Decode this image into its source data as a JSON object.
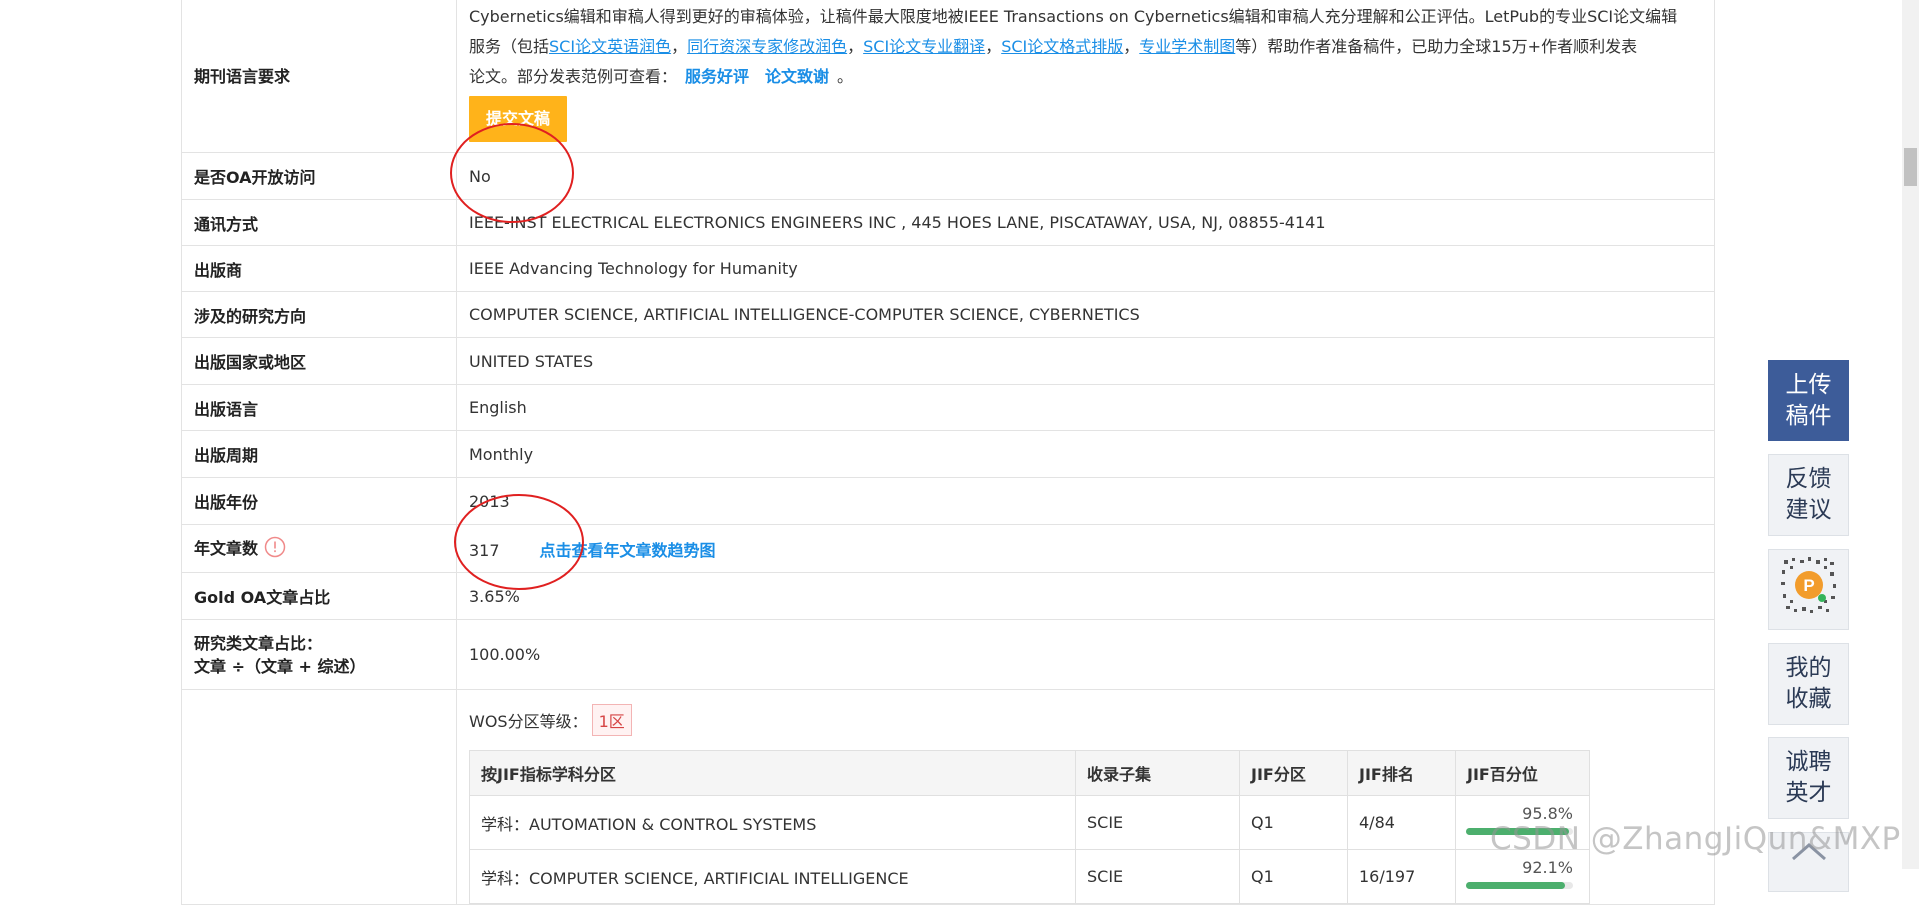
{
  "rows": {
    "lang_req": {
      "label": "期刊语言要求",
      "line1": "Cybernetics编辑和审稿人得到更好的审稿体验，让稿件最大限度地被IEEE Transactions on Cybernetics编辑和审稿人充分理解和公正评估。LetPub的专业SCI论文编辑",
      "line2_prefix": "服务（包括",
      "links": [
        "SCI论文英语润色",
        "同行资深专家修改润色",
        "SCI论文专业翻译",
        "SCI论文格式排版",
        "专业学术制图"
      ],
      "sep": "，",
      "line2_suffix": "等）帮助作者准备稿件，已助力全球15万+作者顺利发表",
      "line3_prefix": "论文。部分发表范例可查看：",
      "link_reviews": "服务好评",
      "link_thanks": "论文致谢",
      "line3_end": "。",
      "submit_button": "提交文稿"
    },
    "oa": {
      "label": "是否OA开放访问",
      "value": "No"
    },
    "contact": {
      "label": "通讯方式",
      "value": "IEEE-INST ELECTRICAL ELECTRONICS ENGINEERS INC , 445 HOES LANE, PISCATAWAY, USA, NJ, 08855-4141"
    },
    "publisher": {
      "label": "出版商",
      "value": "IEEE Advancing Technology for Humanity"
    },
    "research": {
      "label": "涉及的研究方向",
      "value": "COMPUTER SCIENCE, ARTIFICIAL INTELLIGENCE-COMPUTER SCIENCE, CYBERNETICS"
    },
    "country": {
      "label": "出版国家或地区",
      "value": "UNITED STATES"
    },
    "language": {
      "label": "出版语言",
      "value": "English"
    },
    "frequency": {
      "label": "出版周期",
      "value": "Monthly"
    },
    "year": {
      "label": "出版年份",
      "value": "2013"
    },
    "articles": {
      "label": "年文章数",
      "value": "317",
      "trend_link": "点击查看年文章数趋势图"
    },
    "gold_oa": {
      "label": "Gold OA文章占比",
      "value": "3.65%"
    },
    "research_ratio": {
      "label_line1": "研究类文章占比：",
      "label_line2": "文章 ÷（文章 + 综述）",
      "value": "100.00%"
    }
  },
  "wos": {
    "label": "WOS分区等级：",
    "badge": "1区",
    "headers": [
      "按JIF指标学科分区",
      "收录子集",
      "JIF分区",
      "JIF排名",
      "JIF百分位"
    ],
    "rows": [
      {
        "subject": "学科：AUTOMATION & CONTROL SYSTEMS",
        "subset": "SCIE",
        "quartile": "Q1",
        "rank": "4/84",
        "percentile": "95.8%",
        "percentile_fraction": 0.958
      },
      {
        "subject": "学科：COMPUTER SCIENCE, ARTIFICIAL INTELLIGENCE",
        "subset": "SCIE",
        "quartile": "Q1",
        "rank": "16/197",
        "percentile": "92.1%",
        "percentile_fraction": 0.921
      }
    ]
  },
  "sidebar": {
    "upload": [
      "上传",
      "稿件"
    ],
    "feedback": [
      "反馈",
      "建议"
    ],
    "favorites": [
      "我的",
      "收藏"
    ],
    "jobs": [
      "诚聘",
      "英才"
    ]
  },
  "watermark": "CSDN @ZhangJiQun&MXP",
  "colors": {
    "link": "#1a8ee6",
    "submit": "#ffb31a",
    "primary_side": "#3d5c99",
    "annotation": "#e02020",
    "bar_fill": "#4caf6d"
  },
  "icons": {
    "warning": "warning-circle-icon",
    "qr": "qr-code-icon",
    "scroll_top": "scroll-top-icon"
  }
}
